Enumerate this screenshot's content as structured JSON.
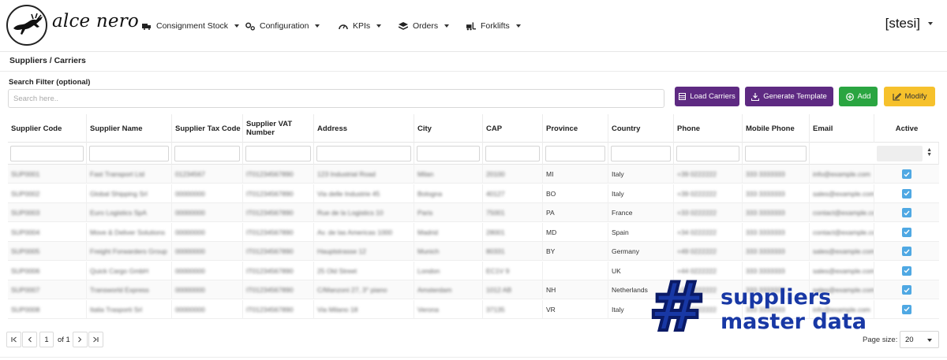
{
  "brand": {
    "name": "alce nero"
  },
  "nav": [
    {
      "label": "Consignment Stock",
      "icon": "truck-loading-icon"
    },
    {
      "label": "Configuration",
      "icon": "gears-icon"
    },
    {
      "label": "KPIs",
      "icon": "gauge-icon"
    },
    {
      "label": "Orders",
      "icon": "layers-icon"
    },
    {
      "label": "Forklifts",
      "icon": "forklift-icon"
    }
  ],
  "user": {
    "name": "[stesi]"
  },
  "page": {
    "title": "Suppliers / Carriers"
  },
  "search": {
    "label": "Search Filter (optional)",
    "placeholder": "Search here.."
  },
  "buttons": {
    "load": "Load Carriers",
    "generate": "Generate Template",
    "add": "Add",
    "modify": "Modify"
  },
  "table": {
    "headers": [
      "Supplier Code",
      "Supplier Name",
      "Supplier Tax Code",
      "Supplier VAT Number",
      "Address",
      "City",
      "CAP",
      "Province",
      "Country",
      "Phone",
      "Mobile Phone",
      "Email",
      "Active"
    ],
    "rows": [
      [
        "SUP0001",
        "Fast Transport Ltd",
        "01234567",
        "IT01234567890",
        "123 Industrial Road",
        "Milan",
        "20100",
        "MI",
        "Italy",
        "+39 0222222",
        "333 3333333",
        "info@example.com",
        true
      ],
      [
        "SUP0002",
        "Global Shipping Srl",
        "00000000",
        "IT01234567890",
        "Via delle Industrie 45",
        "Bologna",
        "40127",
        "BO",
        "Italy",
        "+39 0222222",
        "333 3333333",
        "sales@example.com",
        true
      ],
      [
        "SUP0003",
        "Euro Logistics SpA",
        "00000000",
        "IT01234567890",
        "Rue de la Logistics 10",
        "Paris",
        "75001",
        "PA",
        "France",
        "+33 0222222",
        "333 3333333",
        "contact@example.com",
        true
      ],
      [
        "SUP0004",
        "Move & Deliver Solutions",
        "00000000",
        "IT01234567890",
        "Av. de las Americas 1000",
        "Madrid",
        "28001",
        "MD",
        "Spain",
        "+34 0222222",
        "333 3333333",
        "contact@example.com",
        true
      ],
      [
        "SUP0005",
        "Freight Forwarders Group",
        "00000000",
        "IT01234567890",
        "Hauptstrasse 12",
        "Munich",
        "80331",
        "BY",
        "Germany",
        "+49 0222222",
        "333 3333333",
        "sales@example.com",
        true
      ],
      [
        "SUP0006",
        "Quick Cargo GmbH",
        "00000000",
        "IT01234567890",
        "25 Old Street",
        "London",
        "EC1V 9",
        "",
        "UK",
        "+44 0222222",
        "333 3333333",
        "sales@example.com",
        true
      ],
      [
        "SUP0007",
        "Transworld Express",
        "00000000",
        "IT01234567890",
        "C/Manzoni 27, 3° piano",
        "Amsterdam",
        "1012 AB",
        "NH",
        "Netherlands",
        "+31 0222222",
        "333 3333333",
        "sales@example.com",
        true
      ],
      [
        "SUP0008",
        "Italia Trasporti Srl",
        "00000000",
        "IT01234567890",
        "Via Milano 18",
        "Verona",
        "37135",
        "VR",
        "Italy",
        "+39 0222222",
        "333 3333333",
        "info@example.com",
        true
      ]
    ]
  },
  "pagination": {
    "page": "1",
    "of_label": "of 1",
    "size_label": "Page size:",
    "size": "20"
  },
  "overlay": {
    "hash": "#",
    "line1": "suppliers",
    "line2": "master data"
  }
}
